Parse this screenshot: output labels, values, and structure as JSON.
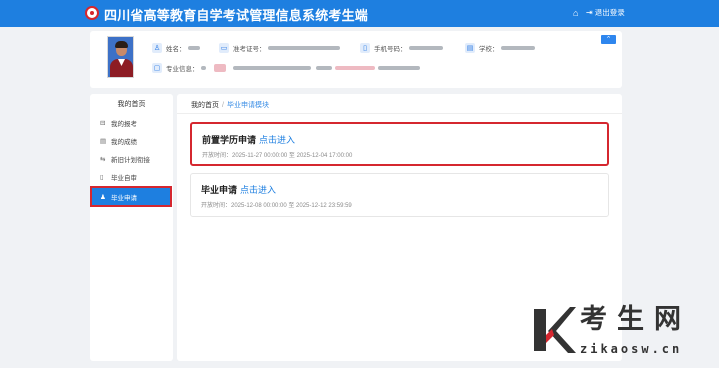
{
  "header": {
    "app_title": "四川省高等教育自学考试管理信息系统考生端",
    "home_icon": "home-icon",
    "logout_label": "退出登录",
    "logout_icon": "logout-icon",
    "brand_color": "#1e7fe0"
  },
  "profile": {
    "name_label": "姓名：",
    "admission_label": "准考证号：",
    "phone_label": "手机号码：",
    "school_label": "学校：",
    "major_label": "专业信息：",
    "collapse_icon": "chevron-up-icon"
  },
  "sidebar": {
    "heading": "我的首页",
    "items": [
      {
        "label": "我的报考",
        "icon": "calendar-icon"
      },
      {
        "label": "我的成绩",
        "icon": "document-icon"
      },
      {
        "label": "新旧计划衔接",
        "icon": "link-icon"
      },
      {
        "label": "毕业自审",
        "icon": "file-icon"
      },
      {
        "label": "毕业申请",
        "icon": "user-icon",
        "active": true
      }
    ]
  },
  "breadcrumb": {
    "home": "我的首页",
    "separator": "/",
    "current": "毕业申请模块"
  },
  "cards": [
    {
      "title": "前置学历申请",
      "link": "点击进入",
      "time": "开放时间：2025-11-27 00:00:00 至 2025-12-04 17:00:00",
      "highlighted": true
    },
    {
      "title": "毕业申请",
      "link": "点击进入",
      "time": "开放时间：2025-12-08 00:00:00 至 2025-12-12 23:59:59",
      "highlighted": false
    }
  ],
  "watermark": {
    "cn": "考生网",
    "url": "zikaosw.cn"
  }
}
